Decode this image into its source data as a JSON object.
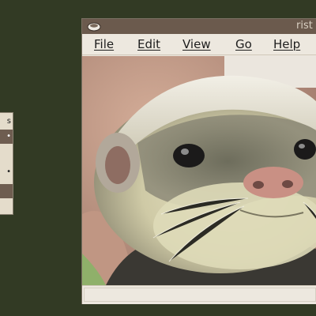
{
  "window": {
    "title_fragment": "rist"
  },
  "menubar": {
    "items": [
      "File",
      "Edit",
      "View",
      "Go",
      "Help"
    ]
  },
  "side_panel": {
    "row_labels": [
      "s",
      "•",
      "",
      "•",
      ""
    ]
  },
  "image": {
    "subject": "ferret-photo"
  },
  "colors": {
    "desktop": "#323a24",
    "titlebar": "#6b5a4d",
    "menubar": "#ede8df"
  }
}
